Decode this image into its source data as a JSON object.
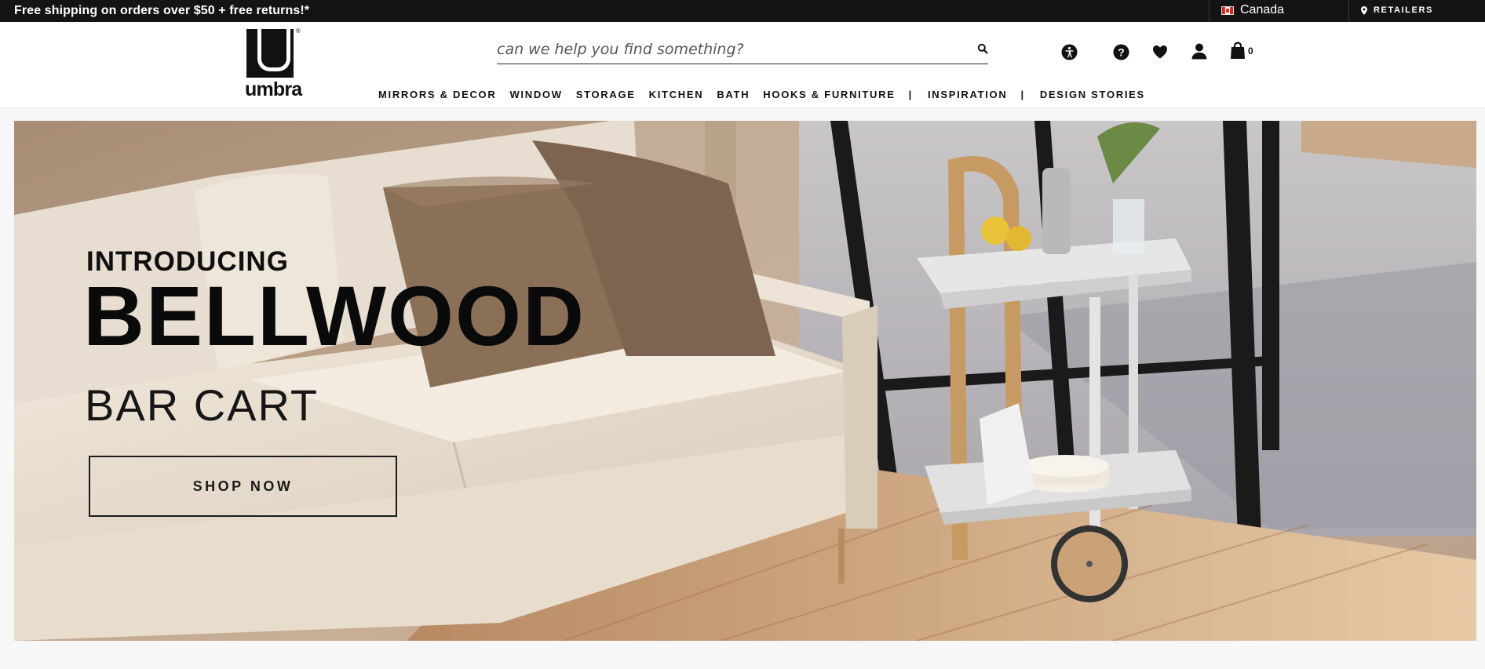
{
  "topbar": {
    "promo": "Free shipping on orders over $50 + free returns!*",
    "country": "Canada",
    "retailers": "RETAILERS"
  },
  "header": {
    "logo_text": "umbra",
    "logo_reg": "®",
    "search_placeholder": "can we help you find something?",
    "cart_count": "0",
    "icons": [
      "accessibility-icon",
      "help-icon",
      "heart-icon",
      "account-icon",
      "shopping-bag-icon"
    ]
  },
  "nav": {
    "items": [
      "MIRRORS & DECOR",
      "WINDOW",
      "STORAGE",
      "KITCHEN",
      "BATH",
      "HOOKS & FURNITURE",
      "INSPIRATION",
      "DESIGN STORIES"
    ],
    "separator": "|"
  },
  "hero": {
    "eyebrow": "INTRODUCING",
    "title": "BELLWOOD",
    "subtitle": "BAR CART",
    "cta": "SHOP NOW"
  },
  "colors": {
    "topbar_bg": "#141414",
    "text": "#111111",
    "hero_wall": "#b99e86",
    "sofa": "#ebe2d4"
  }
}
